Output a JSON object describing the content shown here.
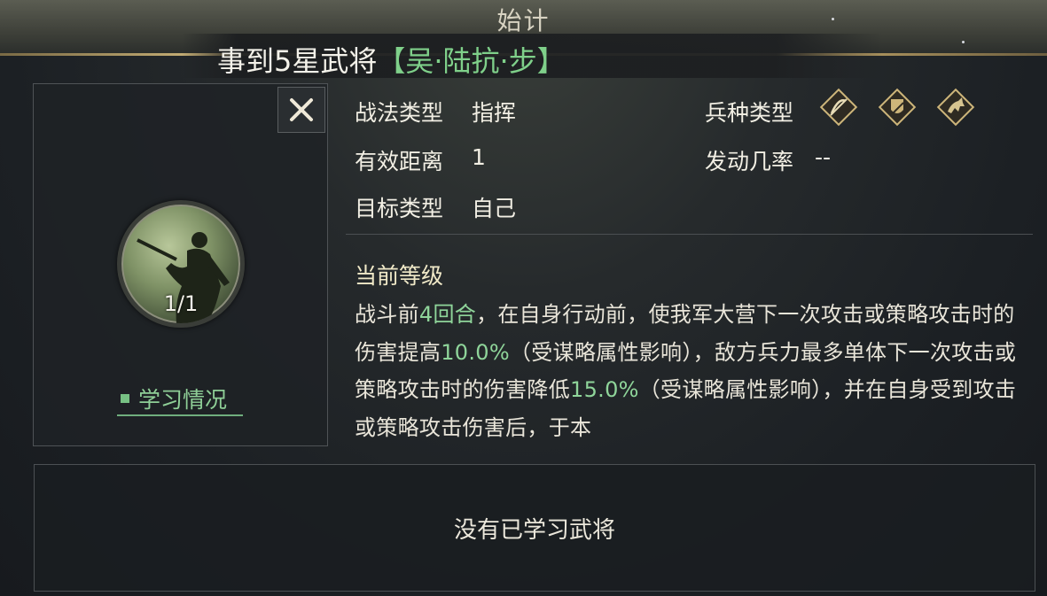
{
  "header": {
    "skill_name": "始计",
    "title_prefix": "事到5星武将",
    "title_general": "【吴·陆抗·步】"
  },
  "left_panel": {
    "close_icon": "close-icon",
    "portrait_count": "1/1",
    "learn_label": "学习情况"
  },
  "info": {
    "tactic_type_label": "战法类型",
    "tactic_type_value": "指挥",
    "range_label": "有效距离",
    "range_value": "1",
    "target_label": "目标类型",
    "target_value": "自己",
    "unit_type_label": "兵种类型",
    "trigger_rate_label": "发动几率",
    "trigger_rate_value": "--",
    "unit_icons": [
      "archer-icon",
      "shield-infantry-icon",
      "cavalry-icon"
    ]
  },
  "level": {
    "title": "当前等级",
    "desc_1": "战斗前",
    "desc_turns": "4回合",
    "desc_2": "，在自身行动前，使我军大营下一次攻击或策略攻击时的伤害提高",
    "desc_pct1": "10.0%",
    "desc_3": "（受谋略属性影响），敌方兵力最多单体下一次攻击或策略攻击时的伤害降低",
    "desc_pct2": "15.0%",
    "desc_4": "（受谋略属性影响），并在自身受到攻击或策略攻击伤害后，于本"
  },
  "bottom": {
    "no_generals": "没有已学习武将"
  },
  "colors": {
    "highlight_green": "#8fd59a",
    "gold_line": "#cdb57a",
    "panel_border": "#4f5356"
  }
}
